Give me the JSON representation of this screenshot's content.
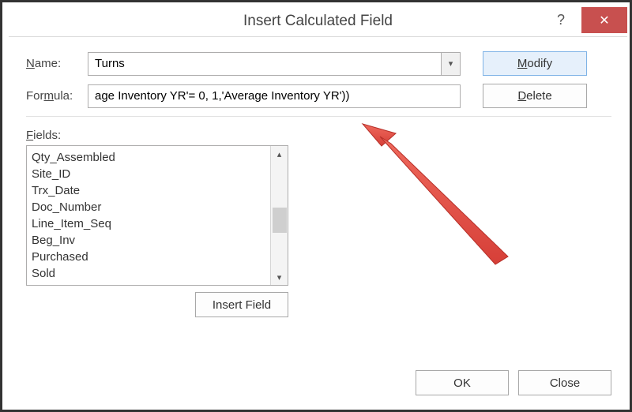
{
  "window": {
    "title": "Insert Calculated Field"
  },
  "form": {
    "name_label": "Name:",
    "name_value": "Turns",
    "formula_label": "Formula:",
    "formula_value": "age Inventory YR'= 0, 1,'Average Inventory YR'))"
  },
  "buttons": {
    "modify": "Modify",
    "delete": "Delete",
    "insert_field": "Insert Field",
    "ok": "OK",
    "close": "Close"
  },
  "fields": {
    "label": "Fields:",
    "items": [
      "Qty_Assembled",
      "Site_ID",
      "Trx_Date",
      "Doc_Number",
      "Line_Item_Seq",
      "Beg_Inv",
      "Purchased",
      "Sold"
    ]
  }
}
